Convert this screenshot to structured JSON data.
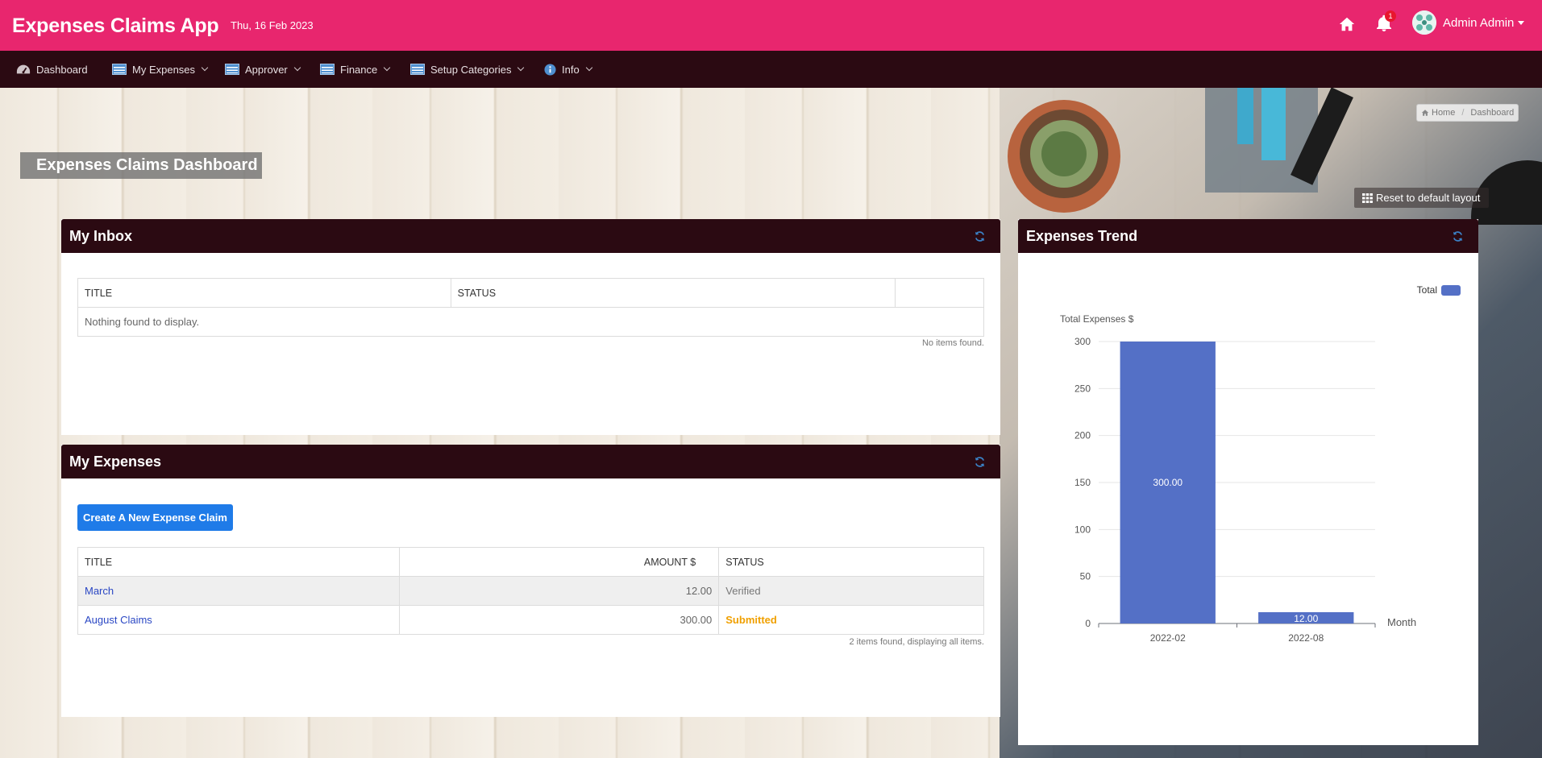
{
  "header": {
    "app_title": "Expenses Claims App",
    "date": "Thu, 16 Feb 2023",
    "notification_count": "1",
    "user_name": "Admin Admin",
    "icons": [
      "home-icon",
      "bell-icon",
      "avatar"
    ]
  },
  "nav": {
    "items": [
      {
        "label": "Dashboard",
        "icon": "dashboard-icon",
        "dropdown": false
      },
      {
        "label": "My Expenses",
        "icon": "table-icon",
        "dropdown": true
      },
      {
        "label": "Approver",
        "icon": "table-icon",
        "dropdown": true
      },
      {
        "label": "Finance",
        "icon": "table-icon",
        "dropdown": true
      },
      {
        "label": "Setup Categories",
        "icon": "table-icon",
        "dropdown": true
      },
      {
        "label": "Info",
        "icon": "info-icon",
        "dropdown": true
      }
    ]
  },
  "breadcrumb": {
    "home": "Home",
    "current": "Dashboard"
  },
  "page": {
    "title": "Expenses Claims Dashboard",
    "reset_label": "Reset to default layout"
  },
  "inbox": {
    "title": "My Inbox",
    "columns": [
      "TITLE",
      "STATUS",
      ""
    ],
    "empty_message": "Nothing found to display.",
    "footer": "No items found."
  },
  "expenses": {
    "title": "My Expenses",
    "create_label": "Create A New Expense Claim",
    "columns": [
      "TITLE",
      "AMOUNT $",
      "STATUS"
    ],
    "rows": [
      {
        "title": "March",
        "amount": "12.00",
        "status": "Verified"
      },
      {
        "title": "August Claims",
        "amount": "300.00",
        "status": "Submitted"
      }
    ],
    "footer": "2 items found, displaying all items.",
    "status_colors": {
      "Verified": "#777777",
      "Submitted": "#f0a000"
    }
  },
  "trend": {
    "title": "Expenses Trend"
  },
  "chart_data": {
    "type": "bar",
    "categories": [
      "2022-02",
      "2022-08"
    ],
    "series": [
      {
        "name": "Total",
        "values": [
          300,
          12
        ],
        "labels": [
          "300.00",
          "12.00"
        ],
        "color": "#5470c6"
      }
    ],
    "ylabel": "Total Expenses $",
    "xlabel": "Month",
    "ylim": [
      0,
      300
    ],
    "yticks": [
      0,
      50,
      100,
      150,
      200,
      250,
      300
    ],
    "grid": true,
    "legend": "top-right"
  },
  "colors": {
    "brand": "#e8266e",
    "nav": "#2b0a12",
    "primary_button": "#1f7be8",
    "link": "#2a47c4"
  }
}
